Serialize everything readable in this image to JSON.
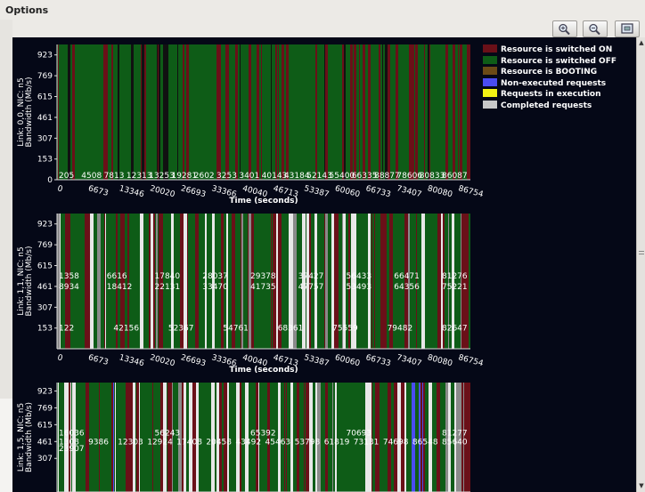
{
  "window": {
    "menu_title": "Options"
  },
  "toolbar": {
    "icons": [
      "zoom-in-icon",
      "zoom-out-icon",
      "fit-window-icon"
    ]
  },
  "legend": [
    {
      "label": "Resource is switched ON",
      "color": "#6a1018"
    },
    {
      "label": "Resource is switched OFF",
      "color": "#0e5c17"
    },
    {
      "label": "Resource is BOOTING",
      "color": "#6b4a16"
    },
    {
      "label": "Non-executed requests",
      "color": "#4a4cf0"
    },
    {
      "label": "Requests in execution",
      "color": "#f2f214"
    },
    {
      "label": "Completed requests",
      "color": "#c8c8c8"
    }
  ],
  "chart_data": [
    {
      "type": "heatmap",
      "ylabel": "Link: 0,0, NIC: n5\nBandwidth (Mb/s)",
      "xlabel": "Time (seconds)",
      "x_ticks": [
        "0",
        "6673",
        "13346",
        "20020",
        "26693",
        "33366",
        "40040",
        "46713",
        "53387",
        "60060",
        "66733",
        "73407",
        "80080",
        "86754"
      ],
      "y_ticks": [
        "0",
        "153",
        "307",
        "461",
        "615",
        "769",
        "923"
      ],
      "xlim": [
        0,
        86754
      ],
      "ylim": [
        0,
        1000
      ],
      "dominant_state": "Resource is switched OFF",
      "annotations_row": [
        {
          "y": 0,
          "labels": [
            "205",
            "4508",
            "7813",
            "12313",
            "13253",
            "19281",
            "2602",
            "3253",
            "3401",
            "40143",
            "43184",
            "52143",
            "55400",
            "66335",
            "88877",
            "78606",
            "80833",
            "86087"
          ]
        }
      ]
    },
    {
      "type": "heatmap",
      "ylabel": "Link: 1,1, NIC: n5\nBandwidth (Mb/s)",
      "xlabel": "Time (seconds)",
      "x_ticks": [
        "0",
        "6673",
        "13346",
        "20020",
        "26693",
        "33366",
        "40040",
        "46713",
        "53387",
        "60060",
        "66733",
        "73407",
        "80080",
        "86754"
      ],
      "y_ticks": [
        "153",
        "307",
        "461",
        "615",
        "769",
        "923"
      ],
      "xlim": [
        0,
        86754
      ],
      "ylim": [
        0,
        1000
      ],
      "annotations_row": [
        {
          "y": 540,
          "labels": [
            "1358",
            "6616",
            "17840",
            "28037",
            "29378",
            "37427",
            "56433",
            "66471",
            "81276"
          ]
        },
        {
          "y": 461,
          "labels": [
            "8934",
            "18412",
            "22131",
            "33470",
            "41735",
            "47757",
            "53493",
            "64356",
            "75221"
          ]
        },
        {
          "y": 153,
          "labels": [
            "122",
            "42156",
            "52367",
            "54761",
            "68361",
            "75559",
            "79482",
            "82647"
          ]
        }
      ]
    },
    {
      "type": "heatmap",
      "ylabel": "Link: 1,5, NIC: n5\nBandwidth (Mb/s)",
      "xlabel": "",
      "x_ticks": [],
      "y_ticks": [
        "307",
        "461",
        "615",
        "769",
        "923"
      ],
      "xlim": [
        0,
        86754
      ],
      "ylim": [
        0,
        1000
      ],
      "annotations_row": [
        {
          "y": 540,
          "labels": [
            "16036",
            "56243",
            "65392",
            "70693",
            "81277"
          ]
        },
        {
          "y": 461,
          "labels": [
            "1308",
            "9386",
            "12303",
            "12924",
            "17408",
            "20458",
            "43492",
            "45463",
            "53798",
            "61819",
            "73131",
            "74698",
            "86548",
            "85640"
          ]
        },
        {
          "y": 400,
          "labels": [
            "23907"
          ]
        }
      ]
    }
  ]
}
